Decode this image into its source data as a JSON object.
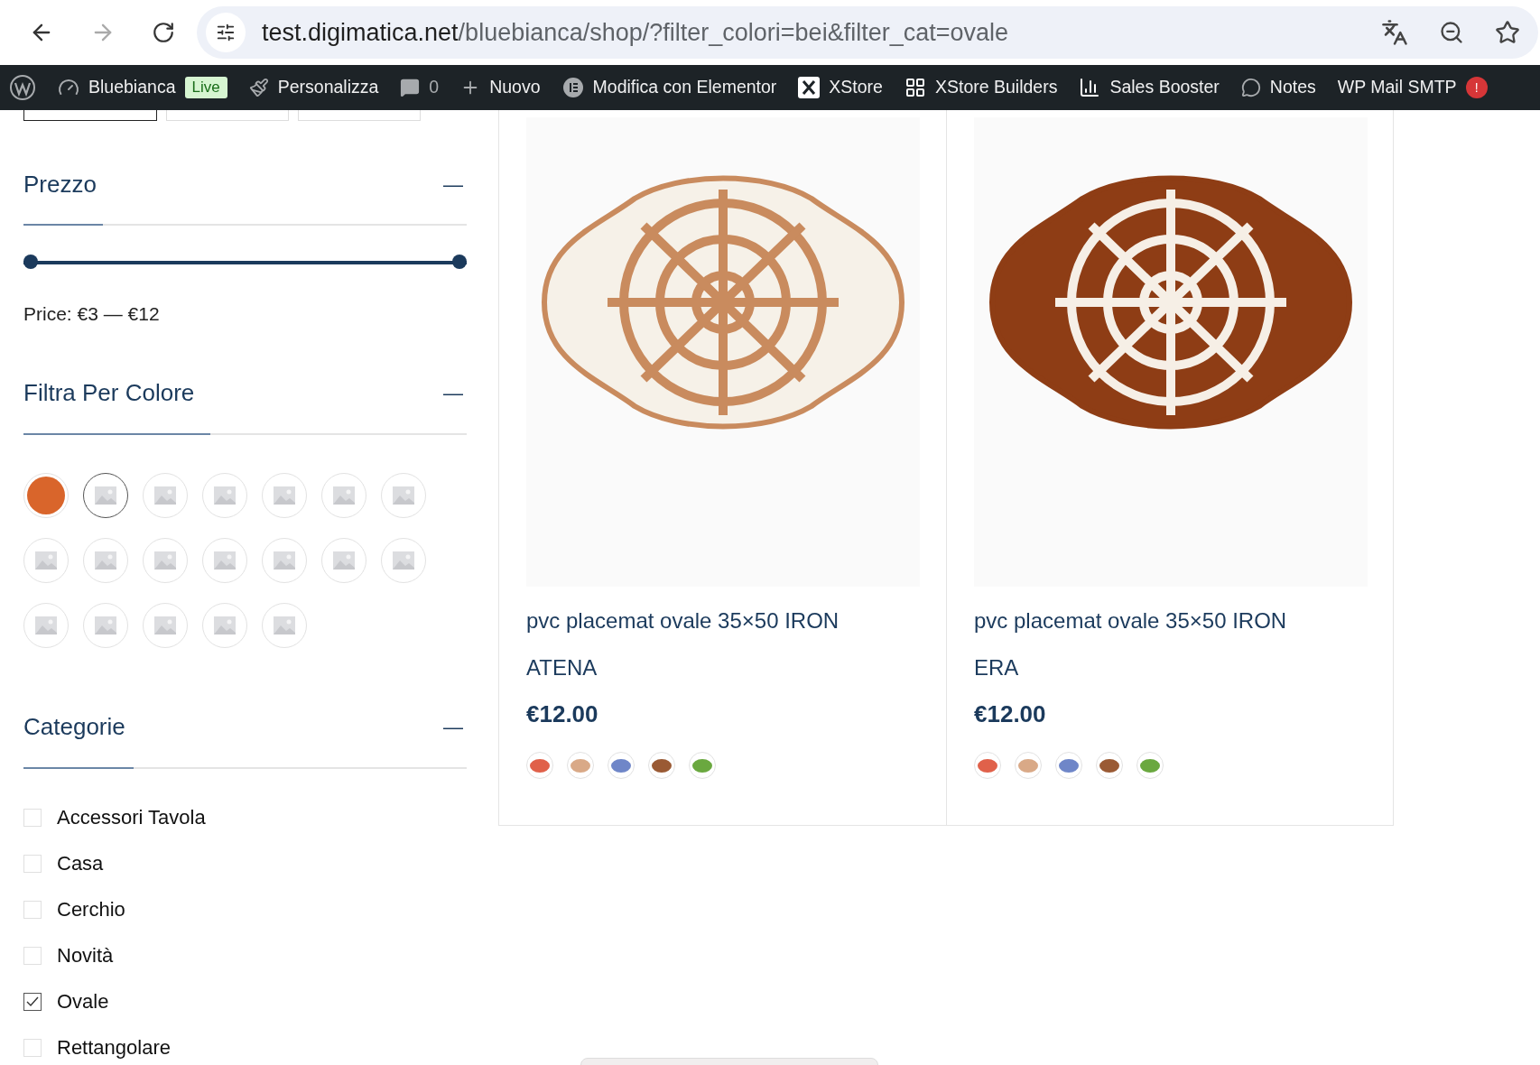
{
  "browser": {
    "url_host": "test.digimatica.net",
    "url_path": "/bluebianca/shop/?filter_colori=bei&filter_cat=ovale"
  },
  "admin_bar": {
    "site": "Bluebianca",
    "live_badge": "Live",
    "items": [
      {
        "kind": "customize",
        "label": "Personalizza"
      },
      {
        "kind": "comments",
        "label": "0"
      },
      {
        "kind": "new",
        "label": "Nuovo"
      },
      {
        "kind": "elementor",
        "label": "Modifica con Elementor"
      },
      {
        "kind": "xstore",
        "label": "XStore"
      },
      {
        "kind": "builders",
        "label": "XStore Builders"
      },
      {
        "kind": "sales",
        "label": "Sales Booster"
      },
      {
        "kind": "notes",
        "label": "Notes"
      },
      {
        "kind": "smtp",
        "label": "WP Mail SMTP",
        "badge": "!"
      }
    ]
  },
  "sidebar": {
    "price": {
      "title": "Prezzo",
      "toggle": "—",
      "level": 1,
      "reading": "Price: €3 — €12"
    },
    "colors": {
      "title": "Filtra Per Colore",
      "toggle": "—",
      "swatches": [
        {
          "kind": "color",
          "color": "#d9652b",
          "selected": false
        },
        {
          "kind": "image",
          "selected": true
        },
        {
          "kind": "image",
          "selected": false
        },
        {
          "kind": "image",
          "selected": false
        },
        {
          "kind": "image",
          "selected": false
        },
        {
          "kind": "image",
          "selected": false
        },
        {
          "kind": "image",
          "selected": false
        },
        {
          "kind": "image",
          "selected": false
        },
        {
          "kind": "image",
          "selected": false
        },
        {
          "kind": "image",
          "selected": false
        },
        {
          "kind": "image",
          "selected": false
        },
        {
          "kind": "image",
          "selected": false
        },
        {
          "kind": "image",
          "selected": false
        },
        {
          "kind": "image",
          "selected": false
        },
        {
          "kind": "image",
          "selected": false
        },
        {
          "kind": "image",
          "selected": false
        },
        {
          "kind": "image",
          "selected": false
        },
        {
          "kind": "image",
          "selected": false
        },
        {
          "kind": "image",
          "selected": false
        }
      ]
    },
    "categories": {
      "title": "Categorie",
      "toggle": "—",
      "items": [
        {
          "label": "Accessori Tavola",
          "checked": false
        },
        {
          "label": "Casa",
          "checked": false
        },
        {
          "label": "Cerchio",
          "checked": false
        },
        {
          "label": "Novità",
          "checked": false
        },
        {
          "label": "Ovale",
          "checked": true
        },
        {
          "label": "Rettangolare",
          "checked": false
        }
      ]
    }
  },
  "products": [
    {
      "title_line1": "pvc placemat ovale 35×50 IRON",
      "title_line2": "ATENA",
      "price": "€12.00",
      "color": "#c98b5e",
      "variants": [
        {
          "color": "#e0614a"
        },
        {
          "color": "#d9a987"
        },
        {
          "color": "#6f86c8"
        },
        {
          "color": "#9a5a34"
        },
        {
          "color": "#6aa83f"
        }
      ]
    },
    {
      "title_line1": "pvc placemat ovale 35×50 IRON",
      "title_line2": "ERA",
      "price": "€12.00",
      "color": "#8e3d15",
      "variants": [
        {
          "color": "#e0614a"
        },
        {
          "color": "#d9a987"
        },
        {
          "color": "#6f86c8"
        },
        {
          "color": "#9a5a34"
        },
        {
          "color": "#6aa83f"
        }
      ]
    }
  ]
}
